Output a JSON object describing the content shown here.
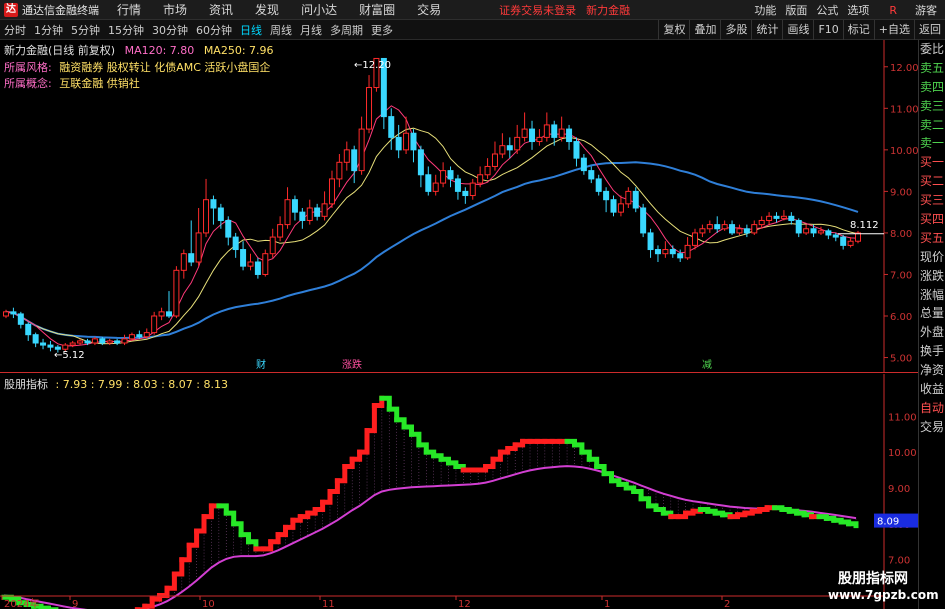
{
  "app": {
    "logo_glyph": "达",
    "title": "通达信金融终端",
    "menu": [
      "行情",
      "市场",
      "资讯",
      "发现",
      "问小达",
      "财富圈",
      "交易"
    ],
    "notice": "证券交易未登录",
    "notice2": "新力金融",
    "right_menu": [
      "功能",
      "版面",
      "公式",
      "选项"
    ],
    "badge": "R",
    "guest": "游客"
  },
  "toolbar": {
    "periods": [
      "分时",
      "1分钟",
      "5分钟",
      "15分钟",
      "30分钟",
      "60分钟",
      "日线",
      "周线",
      "月线",
      "多周期",
      "更多"
    ],
    "active_period": "日线",
    "right_buttons": [
      "复权",
      "叠加",
      "多股",
      "统计",
      "画线",
      "F10",
      "标记",
      "+自选",
      "返回"
    ]
  },
  "main_pane": {
    "stock_name": "新力金融(日线 前复权)",
    "ma120": "MA120: 7.80",
    "ma250": "MA250: 7.96",
    "style_label": "所属风格:",
    "style_value": "融资融券 股权转让 化债AMC 活跃小盘国企",
    "concept_label": "所属概念:",
    "concept_value": "互联金融 供销社",
    "high_label": "12.20",
    "low_label": "5.12",
    "last_price": "8.112",
    "event_markers": [
      "财",
      "涨跌",
      "减"
    ],
    "colors": {
      "up": "#ff2b2b",
      "down": "#3ad8ff",
      "ma_slow": "#2f7fd8",
      "ma_fast": "#e8e07a",
      "ma_mid": "#ff3a7a",
      "axis": "#cc2b2b"
    }
  },
  "indicator_pane": {
    "title": "股朋指标",
    "values": ": 7.93 : 7.99 : 8.03 : 8.07 : 8.13",
    "current": "8.09",
    "colors": {
      "up": "#ff1f1f",
      "down": "#27e827",
      "support": "#d23fd2",
      "box": "#1a2ce0"
    }
  },
  "chart_data": [
    {
      "type": "candlestick",
      "ylim": [
        4.7,
        12.5
      ],
      "yticks": [
        "12.00",
        "11.00",
        "10.00",
        "9.00",
        "8.00",
        "7.00",
        "6.00",
        "5.00"
      ],
      "xticks": [
        "2024年",
        "9",
        "10",
        "11",
        "12",
        "1",
        "2"
      ],
      "candles": [
        [
          6.0,
          6.1,
          6.15,
          5.95
        ],
        [
          6.1,
          6.05,
          6.2,
          5.95
        ],
        [
          6.05,
          5.8,
          6.1,
          5.7
        ],
        [
          5.8,
          5.55,
          5.85,
          5.4
        ],
        [
          5.55,
          5.35,
          5.6,
          5.25
        ],
        [
          5.35,
          5.3,
          5.45,
          5.2
        ],
        [
          5.3,
          5.25,
          5.4,
          5.15
        ],
        [
          5.25,
          5.2,
          5.3,
          5.12
        ],
        [
          5.2,
          5.3,
          5.35,
          5.15
        ],
        [
          5.3,
          5.35,
          5.4,
          5.25
        ],
        [
          5.35,
          5.4,
          5.45,
          5.3
        ],
        [
          5.4,
          5.35,
          5.45,
          5.3
        ],
        [
          5.35,
          5.45,
          5.5,
          5.3
        ],
        [
          5.45,
          5.35,
          5.5,
          5.3
        ],
        [
          5.35,
          5.4,
          5.45,
          5.3
        ],
        [
          5.4,
          5.35,
          5.45,
          5.3
        ],
        [
          5.35,
          5.45,
          5.55,
          5.3
        ],
        [
          5.45,
          5.55,
          5.6,
          5.4
        ],
        [
          5.55,
          5.5,
          5.65,
          5.45
        ],
        [
          5.5,
          5.6,
          5.7,
          5.45
        ],
        [
          5.6,
          6.0,
          6.1,
          5.55
        ],
        [
          6.0,
          6.1,
          6.2,
          5.9
        ],
        [
          6.1,
          6.0,
          6.6,
          5.95
        ],
        [
          6.0,
          7.1,
          7.2,
          5.95
        ],
        [
          7.1,
          7.5,
          7.6,
          6.9
        ],
        [
          7.5,
          7.3,
          8.3,
          7.2
        ],
        [
          7.3,
          8.0,
          8.6,
          7.2
        ],
        [
          8.0,
          8.8,
          9.3,
          7.9
        ],
        [
          8.8,
          8.6,
          8.9,
          8.2
        ],
        [
          8.6,
          8.3,
          8.7,
          8.1
        ],
        [
          8.3,
          7.9,
          8.4,
          7.7
        ],
        [
          7.9,
          7.6,
          8.0,
          7.4
        ],
        [
          7.6,
          7.2,
          7.8,
          7.1
        ],
        [
          7.2,
          7.3,
          7.5,
          7.1
        ],
        [
          7.3,
          7.0,
          7.4,
          6.9
        ],
        [
          7.0,
          7.5,
          7.6,
          6.95
        ],
        [
          7.5,
          7.9,
          8.1,
          7.4
        ],
        [
          7.9,
          8.2,
          8.4,
          7.8
        ],
        [
          8.2,
          8.8,
          9.1,
          8.1
        ],
        [
          8.8,
          8.5,
          8.9,
          8.3
        ],
        [
          8.5,
          8.3,
          8.6,
          8.1
        ],
        [
          8.3,
          8.6,
          8.8,
          8.2
        ],
        [
          8.6,
          8.4,
          8.7,
          8.3
        ],
        [
          8.4,
          8.7,
          9.0,
          8.3
        ],
        [
          8.7,
          9.3,
          9.5,
          8.6
        ],
        [
          9.3,
          9.7,
          9.9,
          9.1
        ],
        [
          9.7,
          10.0,
          10.2,
          9.5
        ],
        [
          10.0,
          9.5,
          10.1,
          9.2
        ],
        [
          9.5,
          10.5,
          10.8,
          9.4
        ],
        [
          10.5,
          11.5,
          11.8,
          10.4
        ],
        [
          11.5,
          12.2,
          12.2,
          11.4
        ],
        [
          12.2,
          10.8,
          12.2,
          10.5
        ],
        [
          10.8,
          10.3,
          11.0,
          10.0
        ],
        [
          10.3,
          10.0,
          10.6,
          9.8
        ],
        [
          10.0,
          10.4,
          10.8,
          9.9
        ],
        [
          10.4,
          10.0,
          10.5,
          9.7
        ],
        [
          10.0,
          9.4,
          10.1,
          9.1
        ],
        [
          9.4,
          9.0,
          9.6,
          8.9
        ],
        [
          9.0,
          9.2,
          9.4,
          8.9
        ],
        [
          9.2,
          9.5,
          9.7,
          9.1
        ],
        [
          9.5,
          9.3,
          9.6,
          9.1
        ],
        [
          9.3,
          9.0,
          9.4,
          8.8
        ],
        [
          9.0,
          8.9,
          9.1,
          8.7
        ],
        [
          8.9,
          9.2,
          9.3,
          8.8
        ],
        [
          9.2,
          9.4,
          9.6,
          9.1
        ],
        [
          9.4,
          9.6,
          9.8,
          9.3
        ],
        [
          9.6,
          9.9,
          10.2,
          9.5
        ],
        [
          9.9,
          10.1,
          10.4,
          9.8
        ],
        [
          10.1,
          10.0,
          10.3,
          9.8
        ],
        [
          10.0,
          10.3,
          10.6,
          9.9
        ],
        [
          10.3,
          10.5,
          10.9,
          10.2
        ],
        [
          10.5,
          10.2,
          10.7,
          10.0
        ],
        [
          10.2,
          10.3,
          10.5,
          10.1
        ],
        [
          10.3,
          10.6,
          10.9,
          10.2
        ],
        [
          10.6,
          10.3,
          10.7,
          10.1
        ],
        [
          10.3,
          10.5,
          10.8,
          10.2
        ],
        [
          10.5,
          10.2,
          10.6,
          10.0
        ],
        [
          10.2,
          9.8,
          10.3,
          9.6
        ],
        [
          9.8,
          9.5,
          9.9,
          9.4
        ],
        [
          9.5,
          9.3,
          9.6,
          9.2
        ],
        [
          9.3,
          9.0,
          9.4,
          8.9
        ],
        [
          9.0,
          8.8,
          9.1,
          8.5
        ],
        [
          8.8,
          8.5,
          8.9,
          8.4
        ],
        [
          8.5,
          8.7,
          8.9,
          8.4
        ],
        [
          8.7,
          9.0,
          9.1,
          8.6
        ],
        [
          9.0,
          8.6,
          9.1,
          8.5
        ],
        [
          8.6,
          8.0,
          8.7,
          7.9
        ],
        [
          8.0,
          7.6,
          8.1,
          7.4
        ],
        [
          7.6,
          7.5,
          7.7,
          7.3
        ],
        [
          7.5,
          7.6,
          7.8,
          7.4
        ],
        [
          7.6,
          7.5,
          7.7,
          7.4
        ],
        [
          7.5,
          7.4,
          7.6,
          7.3
        ],
        [
          7.4,
          7.7,
          7.9,
          7.35
        ],
        [
          7.7,
          8.0,
          8.1,
          7.6
        ],
        [
          8.0,
          8.1,
          8.2,
          7.9
        ],
        [
          8.1,
          8.2,
          8.3,
          8.0
        ],
        [
          8.2,
          8.1,
          8.4,
          8.0
        ],
        [
          8.1,
          8.2,
          8.3,
          8.05
        ],
        [
          8.2,
          8.0,
          8.3,
          7.95
        ],
        [
          8.0,
          8.1,
          8.2,
          7.95
        ],
        [
          8.1,
          8.0,
          8.2,
          7.9
        ],
        [
          8.0,
          8.2,
          8.3,
          7.95
        ],
        [
          8.2,
          8.3,
          8.4,
          8.1
        ],
        [
          8.3,
          8.4,
          8.5,
          8.2
        ],
        [
          8.4,
          8.35,
          8.5,
          8.25
        ],
        [
          8.35,
          8.4,
          8.55,
          8.3
        ],
        [
          8.4,
          8.3,
          8.5,
          8.2
        ],
        [
          8.3,
          8.0,
          8.35,
          7.9
        ],
        [
          8.0,
          8.1,
          8.2,
          7.95
        ],
        [
          8.1,
          8.0,
          8.2,
          7.9
        ],
        [
          8.0,
          8.05,
          8.15,
          7.95
        ],
        [
          8.05,
          7.95,
          8.1,
          7.85
        ],
        [
          7.95,
          7.9,
          8.0,
          7.8
        ],
        [
          7.9,
          7.7,
          7.95,
          7.6
        ],
        [
          7.7,
          7.8,
          7.9,
          7.65
        ],
        [
          7.8,
          8.0,
          8.05,
          7.75
        ]
      ]
    },
    {
      "type": "line",
      "ylim": [
        6.6,
        11.9
      ],
      "yticks": [
        "11.00",
        "10.00",
        "9.00",
        "8.00",
        "7.00"
      ],
      "time_ticks": [
        "10:26",
        "10:26",
        "10:26",
        "10:26",
        "10:26",
        "10:26",
        "10:26",
        "10:26",
        "10:26",
        "10:26"
      ],
      "series": [
        {
          "values": [
            5.95,
            5.9,
            5.8,
            5.75,
            5.7,
            5.65,
            5.6,
            5.55,
            5.5,
            5.45,
            5.45,
            5.5,
            5.5,
            5.45,
            5.45,
            5.45,
            5.5,
            5.55,
            5.6,
            5.7,
            5.9,
            6.0,
            6.2,
            6.6,
            7.0,
            7.4,
            7.8,
            8.2,
            8.5,
            8.5,
            8.3,
            8.0,
            7.7,
            7.5,
            7.3,
            7.3,
            7.5,
            7.7,
            7.9,
            8.1,
            8.2,
            8.3,
            8.4,
            8.6,
            8.9,
            9.2,
            9.6,
            9.8,
            10.0,
            10.6,
            11.3,
            11.5,
            11.2,
            10.9,
            10.7,
            10.5,
            10.2,
            10.0,
            9.9,
            9.8,
            9.7,
            9.6,
            9.5,
            9.5,
            9.5,
            9.6,
            9.8,
            10.0,
            10.1,
            10.2,
            10.3,
            10.3,
            10.3,
            10.3,
            10.3,
            10.3,
            10.3,
            10.2,
            10.0,
            9.8,
            9.6,
            9.4,
            9.2,
            9.1,
            9.0,
            8.9,
            8.7,
            8.5,
            8.4,
            8.3,
            8.2,
            8.2,
            8.3,
            8.35,
            8.4,
            8.35,
            8.3,
            8.25,
            8.2,
            8.25,
            8.3,
            8.35,
            8.4,
            8.45,
            8.45,
            8.4,
            8.35,
            8.3,
            8.25,
            8.2,
            8.2,
            8.15,
            8.1,
            8.05,
            8.0,
            7.95
          ]
        },
        {
          "values": [
            6.0,
            5.98,
            5.95,
            5.9,
            5.86,
            5.82,
            5.78,
            5.74,
            5.7,
            5.66,
            5.63,
            5.6,
            5.58,
            5.56,
            5.55,
            5.55,
            5.56,
            5.57,
            5.59,
            5.62,
            5.68,
            5.75,
            5.84,
            5.96,
            6.1,
            6.25,
            6.42,
            6.6,
            6.78,
            6.92,
            7.02,
            7.08,
            7.1,
            7.1,
            7.1,
            7.12,
            7.18,
            7.26,
            7.36,
            7.46,
            7.56,
            7.66,
            7.76,
            7.86,
            7.98,
            8.1,
            8.24,
            8.38,
            8.5,
            8.65,
            8.8,
            8.9,
            8.95,
            8.98,
            9.0,
            9.02,
            9.03,
            9.04,
            9.05,
            9.06,
            9.07,
            9.08,
            9.09,
            9.1,
            9.12,
            9.15,
            9.2,
            9.26,
            9.32,
            9.38,
            9.44,
            9.49,
            9.53,
            9.56,
            9.58,
            9.6,
            9.61,
            9.6,
            9.58,
            9.54,
            9.49,
            9.43,
            9.36,
            9.29,
            9.22,
            9.15,
            9.07,
            8.99,
            8.91,
            8.84,
            8.78,
            8.72,
            8.67,
            8.63,
            8.6,
            8.57,
            8.54,
            8.51,
            8.48,
            8.46,
            8.44,
            8.43,
            8.42,
            8.42,
            8.42,
            8.41,
            8.4,
            8.38,
            8.36,
            8.34,
            8.31,
            8.28,
            8.25,
            8.22,
            8.19,
            8.16
          ]
        }
      ]
    }
  ]
}
